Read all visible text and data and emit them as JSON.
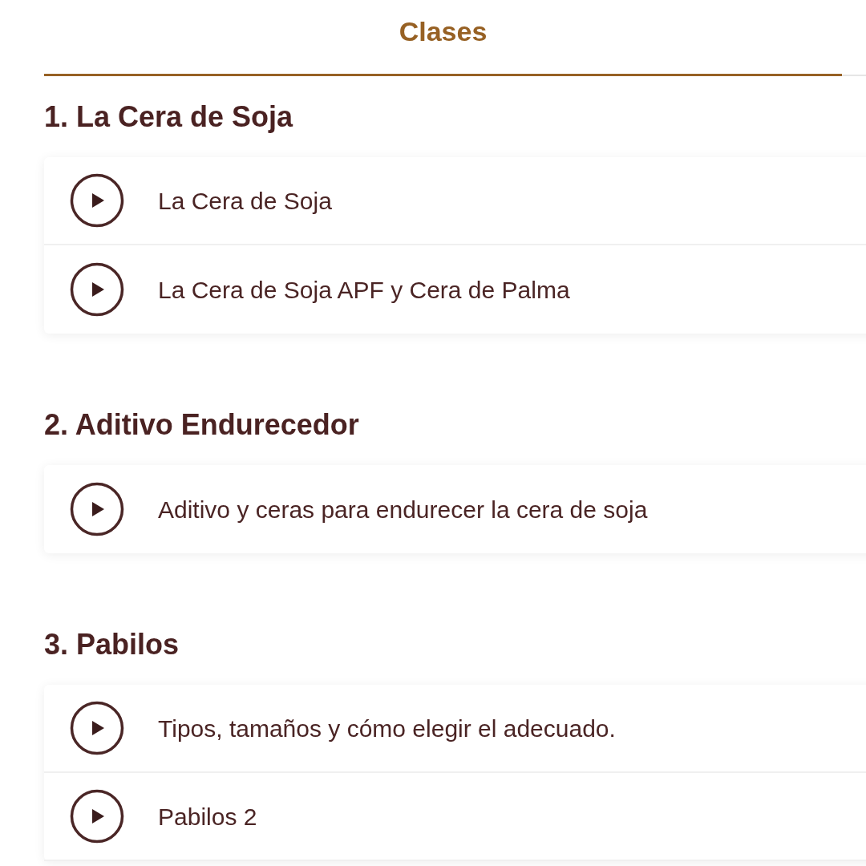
{
  "tabs": [
    {
      "label": "Clases",
      "selected": true
    }
  ],
  "sections": [
    {
      "title": "1. La Cera de Soja",
      "lessons": [
        {
          "title": "La Cera de Soja"
        },
        {
          "title": "La Cera de Soja APF y Cera de Palma"
        }
      ]
    },
    {
      "title": "2. Aditivo Endurecedor",
      "lessons": [
        {
          "title": "Aditivo y ceras para endurecer la cera de soja"
        }
      ]
    },
    {
      "title": "3. Pabilos",
      "lessons": [
        {
          "title": "Tipos, tamaños y cómo elegir el adecuado."
        },
        {
          "title": "Pabilos 2"
        }
      ]
    }
  ]
}
